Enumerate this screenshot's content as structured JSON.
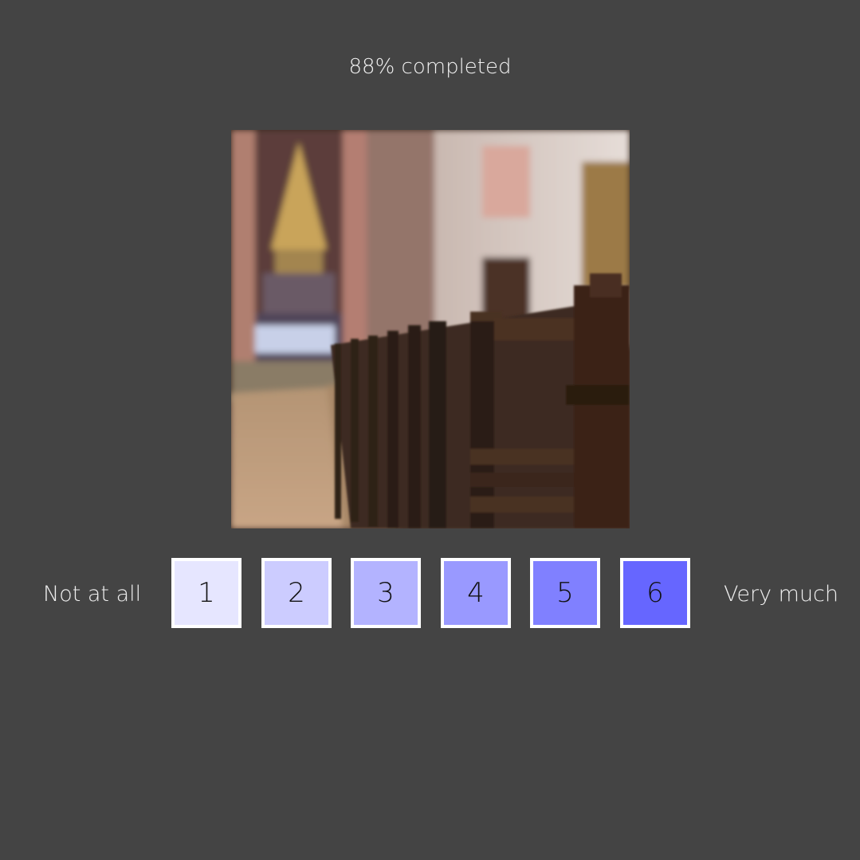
{
  "progress": {
    "text": "88% completed",
    "value": 0.88
  },
  "stimulus": {
    "icon": "church-interior-photo"
  },
  "scale": {
    "left_label": "Not at all",
    "right_label": "Very much",
    "options": [
      {
        "label": "1",
        "color": "#e6e6ff"
      },
      {
        "label": "2",
        "color": "#ccccff"
      },
      {
        "label": "3",
        "color": "#b3b3ff"
      },
      {
        "label": "4",
        "color": "#9999ff"
      },
      {
        "label": "5",
        "color": "#8080ff"
      },
      {
        "label": "6",
        "color": "#6666ff"
      }
    ]
  }
}
